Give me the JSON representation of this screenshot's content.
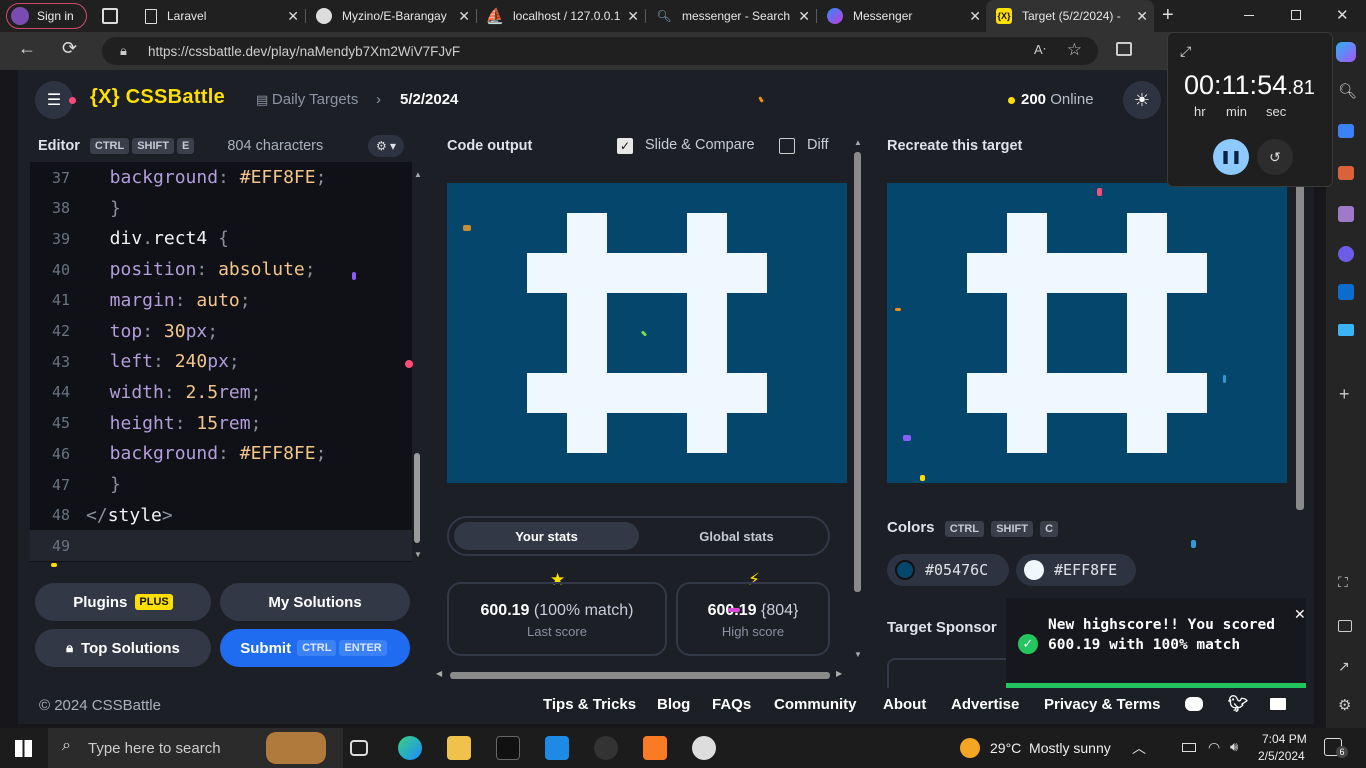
{
  "browser": {
    "signin_label": "Sign in",
    "tabs": [
      {
        "label": "Laravel"
      },
      {
        "label": "Myzino/E-Barangay"
      },
      {
        "label": "localhost / 127.0.0.1"
      },
      {
        "label": "messenger - Search"
      },
      {
        "label": "Messenger"
      },
      {
        "label": "Target (5/2/2024) -"
      }
    ],
    "url": "https://cssbattle.dev/play/naMendyb7Xm2WiV7FJvF"
  },
  "site": {
    "logo": "{X} CSSBattle",
    "breadcrumb_1": "Daily Targets",
    "breadcrumb_2": "5/2/2024",
    "online_count": "200",
    "online_label": "Online"
  },
  "editor": {
    "title": "Editor",
    "shortcut": [
      "CTRL",
      "SHIFT",
      "E"
    ],
    "char_count": "804 characters",
    "lines": [
      {
        "n": "37",
        "parts": [
          [
            "kw",
            "  background"
          ],
          [
            "pun",
            ": "
          ],
          [
            "val",
            "#EFF8FE"
          ],
          [
            "pun",
            ";"
          ]
        ]
      },
      {
        "n": "38",
        "parts": [
          [
            "pun",
            "}"
          ]
        ]
      },
      {
        "n": "39",
        "parts": [
          [
            "sel",
            "  div"
          ],
          [
            "pun",
            "."
          ],
          [
            "sel",
            "rect4 "
          ],
          [
            "pun",
            "{"
          ]
        ]
      },
      {
        "n": "40",
        "parts": [
          [
            "kw",
            "  position"
          ],
          [
            "pun",
            ": "
          ],
          [
            "val",
            "absolute"
          ],
          [
            "pun",
            ";"
          ]
        ]
      },
      {
        "n": "41",
        "parts": [
          [
            "kw",
            "  margin"
          ],
          [
            "pun",
            ": "
          ],
          [
            "val",
            "auto"
          ],
          [
            "pun",
            ";"
          ]
        ]
      },
      {
        "n": "42",
        "parts": [
          [
            "kw",
            "  top"
          ],
          [
            "pun",
            ": "
          ],
          [
            "val",
            "30"
          ],
          [
            "kw",
            "px"
          ],
          [
            "pun",
            ";"
          ]
        ]
      },
      {
        "n": "43",
        "parts": [
          [
            "kw",
            "  left"
          ],
          [
            "pun",
            ": "
          ],
          [
            "val",
            "240"
          ],
          [
            "kw",
            "px"
          ],
          [
            "pun",
            ";"
          ]
        ]
      },
      {
        "n": "44",
        "parts": [
          [
            "kw",
            "  width"
          ],
          [
            "pun",
            ": "
          ],
          [
            "val",
            "2.5"
          ],
          [
            "kw",
            "rem"
          ],
          [
            "pun",
            ";"
          ]
        ]
      },
      {
        "n": "45",
        "parts": [
          [
            "kw",
            "  height"
          ],
          [
            "pun",
            ": "
          ],
          [
            "val",
            "15"
          ],
          [
            "kw",
            "rem"
          ],
          [
            "pun",
            ";"
          ]
        ]
      },
      {
        "n": "46",
        "parts": [
          [
            "kw",
            "  background"
          ],
          [
            "pun",
            ": "
          ],
          [
            "val",
            "#EFF8FE"
          ],
          [
            "pun",
            ";"
          ]
        ]
      },
      {
        "n": "47",
        "parts": [
          [
            "pun",
            "}"
          ]
        ]
      },
      {
        "n": "48",
        "parts": [
          [
            "pun",
            "</"
          ],
          [
            "sel",
            "style"
          ],
          [
            "pun",
            ">"
          ]
        ]
      },
      {
        "n": "49",
        "parts": []
      }
    ]
  },
  "buttons": {
    "plugins": "Plugins",
    "plugins_badge": "PLUS",
    "my_solutions": "My Solutions",
    "top_solutions": "Top Solutions",
    "submit": "Submit",
    "submit_keys": [
      "CTRL",
      "ENTER"
    ]
  },
  "output": {
    "title": "Code output",
    "slide_compare": "Slide & Compare",
    "diff": "Diff",
    "tab_your": "Your stats",
    "tab_global": "Global stats",
    "last_score": "600.19",
    "last_match": "(100% match)",
    "last_label": "Last score",
    "high_score": "600.19",
    "high_chars": "{804}",
    "high_label": "High score"
  },
  "target": {
    "title": "Recreate this target",
    "colors_label": "Colors",
    "colors_keys": [
      "CTRL",
      "SHIFT",
      "C"
    ],
    "colors": [
      "#05476C",
      "#EFF8FE"
    ],
    "sponsor_label": "Target Sponsor"
  },
  "toast": {
    "message": "New highscore!! You scored 600.19 with 100% match"
  },
  "timer": {
    "time_main": "00:11:54",
    "time_frac": ".81",
    "unit_hr": "hr",
    "unit_min": "min",
    "unit_sec": "sec"
  },
  "footer": {
    "copyright": "© 2024 CSSBattle",
    "links": [
      "Tips & Tricks",
      "Blog",
      "FAQs",
      "Community",
      "About",
      "Advertise",
      "Privacy & Terms"
    ]
  },
  "taskbar": {
    "search_placeholder": "Type here to search",
    "weather": "29°C  Mostly sunny",
    "time": "7:04 PM",
    "date": "2/5/2024",
    "notif_count": "6"
  },
  "colors": {
    "canvas_bg": "#05476C",
    "shape": "#EFF8FE",
    "accent": "#1F6CF1",
    "logo": "#FFDF00"
  }
}
